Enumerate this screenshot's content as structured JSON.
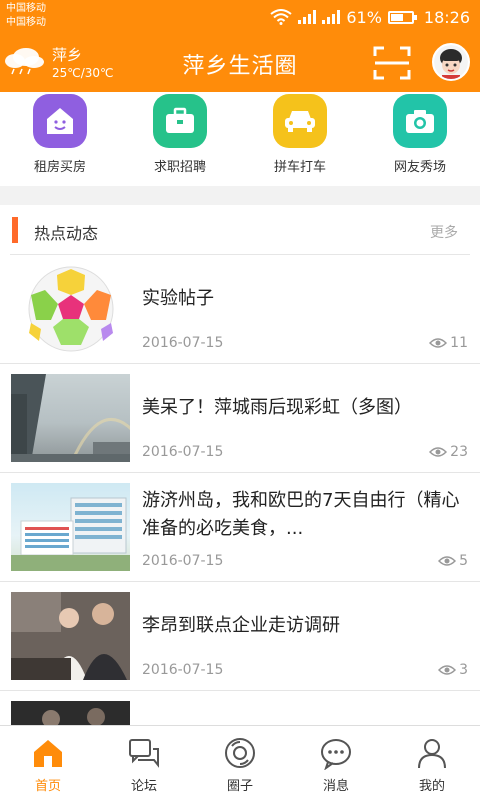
{
  "status": {
    "carrier_1": "中国移动",
    "carrier_2": "中国移动",
    "battery": "61%",
    "battery_level": 0.61,
    "time": "18:26"
  },
  "header": {
    "city": "萍乡",
    "temperature": "25℃/30℃",
    "title": "萍乡生活圈",
    "accent": "#ff8c0a"
  },
  "quick_nav": [
    {
      "label": "租房买房",
      "icon": "house-icon",
      "color": "#8f5fe0"
    },
    {
      "label": "求职招聘",
      "icon": "briefcase-icon",
      "color": "#26c28a"
    },
    {
      "label": "拼车打车",
      "icon": "car-icon",
      "color": "#f5c21b"
    },
    {
      "label": "网友秀场",
      "icon": "camera-icon",
      "color": "#22c4a8"
    }
  ],
  "section": {
    "title": "热点动态",
    "more": "更多"
  },
  "posts": [
    {
      "title": "实验帖子",
      "date": "2016-07-15",
      "views": "11"
    },
    {
      "title": "美呆了！萍城雨后现彩虹（多图）",
      "date": "2016-07-15",
      "views": "23"
    },
    {
      "title": "游济州岛，我和欧巴的7天自由行（精心准备的必吃美食，...",
      "date": "2016-07-15",
      "views": "5"
    },
    {
      "title": "李昂到联点企业走访调研",
      "date": "2016-07-15",
      "views": "3"
    }
  ],
  "tabs": [
    {
      "label": "首页",
      "icon": "home-icon",
      "active": true
    },
    {
      "label": "论坛",
      "icon": "forum-icon",
      "active": false
    },
    {
      "label": "圈子",
      "icon": "circle-icon",
      "active": false
    },
    {
      "label": "消息",
      "icon": "message-icon",
      "active": false
    },
    {
      "label": "我的",
      "icon": "profile-icon",
      "active": false
    }
  ]
}
